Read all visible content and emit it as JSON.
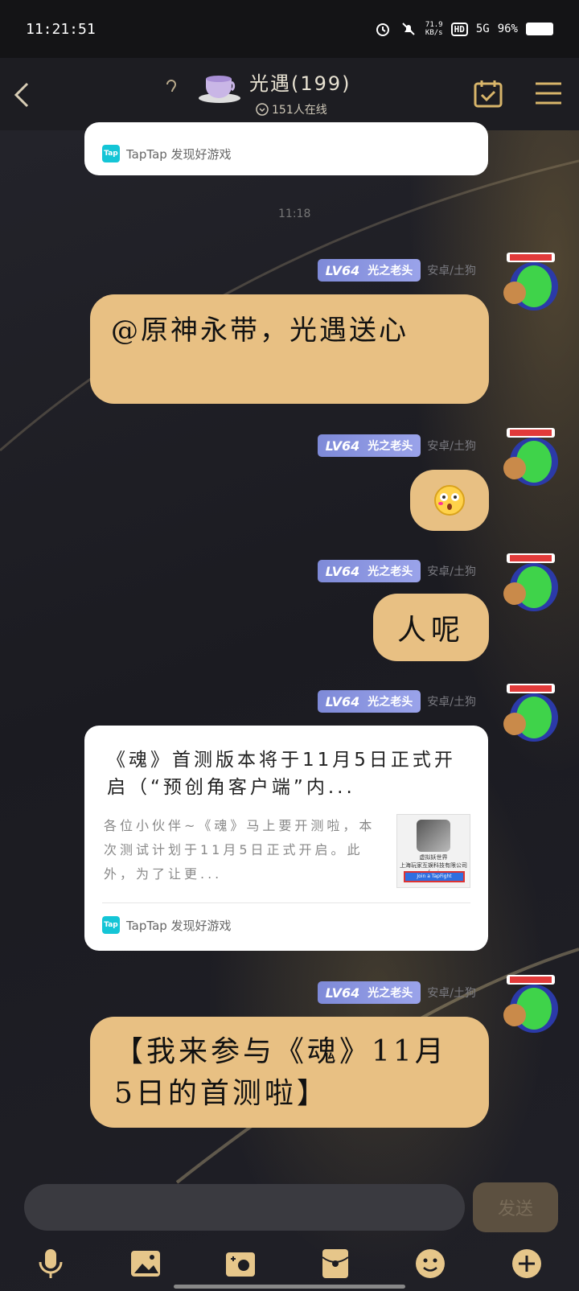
{
  "status_bar": {
    "time": "11:21:51",
    "net_speed_value": "71.9",
    "net_speed_unit": "KB/s",
    "hd_label": "HD",
    "signal_label": "5G",
    "battery": "96%"
  },
  "header": {
    "group_name": "光遇(199)",
    "online_count": "151人在线",
    "icons": [
      "back-chevron-icon",
      "ear-icon",
      "checkin-calendar-icon",
      "menu-icon"
    ]
  },
  "chat": {
    "top_card_source": "TapTap 发现好游戏",
    "timestamp": "11:18",
    "sender": {
      "level": "LV64",
      "title": "光之老头",
      "device": "安卓/土狗"
    },
    "messages": [
      {
        "type": "text",
        "text": "@原神永带，光遇送心"
      },
      {
        "type": "emoji",
        "emoji": "😳"
      },
      {
        "type": "text",
        "text": "人呢"
      },
      {
        "type": "link_card",
        "title": "《魂》首测版本将于11月5日正式开启（“预创角客户端”内...",
        "description": "各位小伙伴~《魂》马上要开测啦，本次测试计划于11月5日正式开启。此外，为了让更...",
        "thumb_caption": "虚拟妖世界\n上海玩家互娱科技有限公司 for i",
        "thumb_button": "Join a TapFight",
        "source": "TapTap 发现好游戏"
      },
      {
        "type": "text",
        "text": "【我来参与《魂》11月5日的首测啦】"
      }
    ]
  },
  "input_bar": {
    "placeholder": "",
    "send_label": "发送",
    "tools": [
      "microphone-icon",
      "image-icon",
      "camera-icon",
      "red-packet-icon",
      "emoji-icon",
      "plus-icon"
    ]
  },
  "colors": {
    "bubble": "#e8c083",
    "level_badge": "#8d97e2",
    "taptap": "#14c5d6"
  }
}
